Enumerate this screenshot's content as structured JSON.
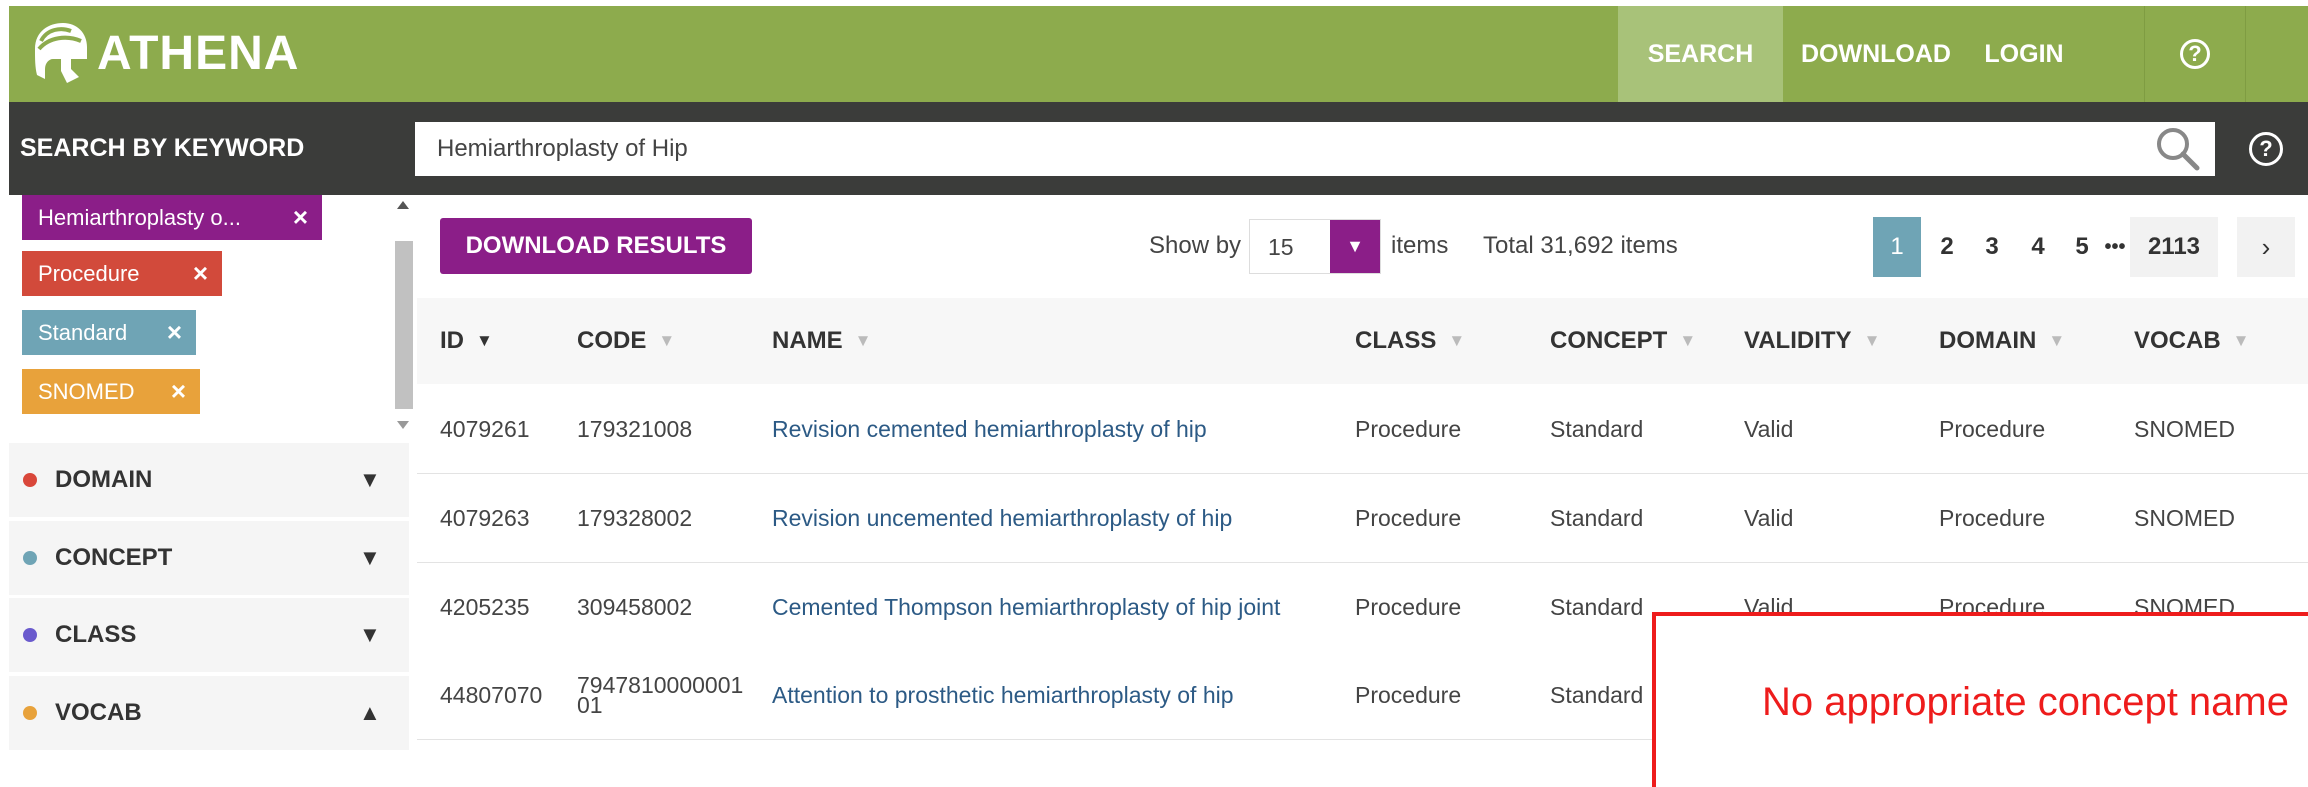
{
  "header": {
    "logo_text": "ATHENA",
    "nav": {
      "search": "SEARCH",
      "download": "DOWNLOAD",
      "login": "LOGIN",
      "help": "?"
    },
    "colors": {
      "header_bg": "#8dab4d",
      "active_tab": "#a8c279"
    }
  },
  "search": {
    "label": "SEARCH BY KEYWORD",
    "value": "Hemiarthroplasty of Hip",
    "help": "?"
  },
  "filters": {
    "chips": [
      {
        "label": "Hemiarthroplasty o...",
        "remove": "×",
        "color": "#8b1e88"
      },
      {
        "label": "Procedure",
        "remove": "×",
        "color": "#d24a3b"
      },
      {
        "label": "Standard",
        "remove": "×",
        "color": "#6fa4b5"
      },
      {
        "label": "SNOMED",
        "remove": "×",
        "color": "#e8a23b"
      }
    ],
    "facets": [
      {
        "label": "DOMAIN",
        "arrow": "▼",
        "color": "#d9473a"
      },
      {
        "label": "CONCEPT",
        "arrow": "▼",
        "color": "#6fa4b5"
      },
      {
        "label": "CLASS",
        "arrow": "▼",
        "color": "#6a5acd"
      },
      {
        "label": "VOCAB",
        "arrow": "▲",
        "color": "#e8a23b"
      }
    ]
  },
  "results": {
    "download_label": "DOWNLOAD RESULTS",
    "show_by_label": "Show by",
    "show_by_value": "15",
    "show_by_arrow": "▼",
    "items_label": "items",
    "total_label": "Total 31,692 items",
    "pagination": {
      "pages": [
        "1",
        "2",
        "3",
        "4",
        "5"
      ],
      "ellipsis": "•••",
      "last": "2113",
      "next": "›",
      "current": 1
    },
    "columns": [
      {
        "label": "ID",
        "sort": "▼"
      },
      {
        "label": "CODE",
        "sort": "▼"
      },
      {
        "label": "NAME",
        "sort": "▼"
      },
      {
        "label": "CLASS",
        "sort": "▼"
      },
      {
        "label": "CONCEPT",
        "sort": "▼"
      },
      {
        "label": "VALIDITY",
        "sort": "▼"
      },
      {
        "label": "DOMAIN",
        "sort": "▼"
      },
      {
        "label": "VOCAB",
        "sort": "▼"
      }
    ],
    "rows": [
      {
        "id": "4079261",
        "code": "179321008",
        "name": "Revision cemented hemiarthroplasty of hip",
        "class": "Procedure",
        "concept": "Standard",
        "validity": "Valid",
        "domain": "Procedure",
        "vocab": "SNOMED"
      },
      {
        "id": "4079263",
        "code": "179328002",
        "name": "Revision uncemented hemiarthroplasty of hip",
        "class": "Procedure",
        "concept": "Standard",
        "validity": "Valid",
        "domain": "Procedure",
        "vocab": "SNOMED"
      },
      {
        "id": "4205235",
        "code": "309458002",
        "name": "Cemented Thompson hemiarthroplasty of hip joint",
        "class": "Procedure",
        "concept": "Standard",
        "validity": "Valid",
        "domain": "Procedure",
        "vocab": "SNOMED"
      },
      {
        "id": "44807070",
        "code_line1": "7947810000001",
        "code_line2": "01",
        "name": "Attention to prosthetic hemiarthroplasty of hip",
        "class": "Procedure",
        "concept": "Standard"
      }
    ]
  },
  "annotation": {
    "text": "No appropriate concept name",
    "color": "#ee1c1c"
  }
}
